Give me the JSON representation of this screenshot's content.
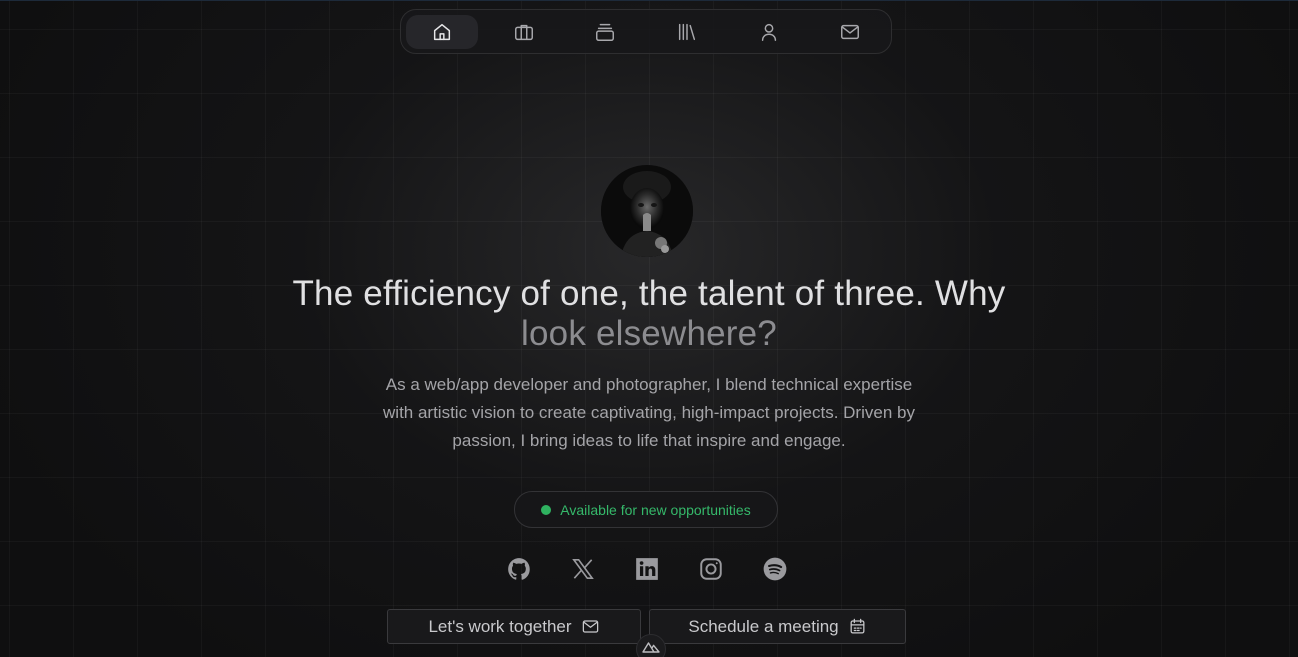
{
  "nav": {
    "items": [
      {
        "icon": "home-icon",
        "active": true
      },
      {
        "icon": "briefcase-icon",
        "active": false
      },
      {
        "icon": "stack-icon",
        "active": false
      },
      {
        "icon": "library-icon",
        "active": false
      },
      {
        "icon": "user-icon",
        "active": false
      },
      {
        "icon": "mail-icon",
        "active": false
      }
    ]
  },
  "hero": {
    "headline_line1": "The efficiency of one, the talent of three. Why",
    "headline_line2": "look elsewhere?",
    "description": "As a web/app developer and photographer, I blend technical expertise with artistic vision to create captivating, high-impact projects. Driven by passion, I bring ideas to life that inspire and engage.",
    "status": "Available for new opportunities",
    "status_color": "#2fb260"
  },
  "socials": [
    "github-icon",
    "x-icon",
    "linkedin-icon",
    "instagram-icon",
    "spotify-icon"
  ],
  "buttons": {
    "work_label": "Let's work together",
    "meeting_label": "Schedule a meeting"
  },
  "colors": {
    "background": "#0f0f10",
    "accent_green": "#2fb260"
  }
}
